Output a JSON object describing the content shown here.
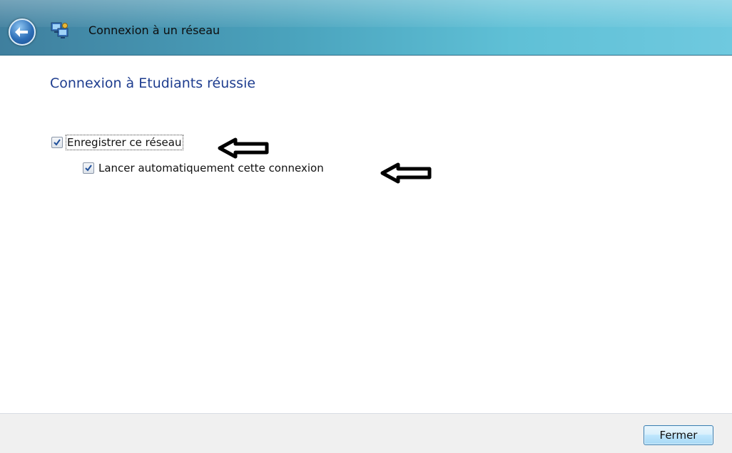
{
  "window": {
    "title": "Connexion à un réseau"
  },
  "main": {
    "heading": "Connexion à Etudiants réussie",
    "options": [
      {
        "label": "Enregistrer ce réseau",
        "checked": true
      },
      {
        "label": "Lancer automatiquement cette connexion",
        "checked": true
      }
    ]
  },
  "footer": {
    "close_label": "Fermer"
  },
  "icons": {
    "back": "back-arrow-icon",
    "network": "network-icon",
    "annotation": "left-arrow-icon"
  },
  "colors": {
    "heading": "#1e3d8f",
    "titlebar": "#4aa3bd",
    "button_border": "#3c7fb1"
  }
}
